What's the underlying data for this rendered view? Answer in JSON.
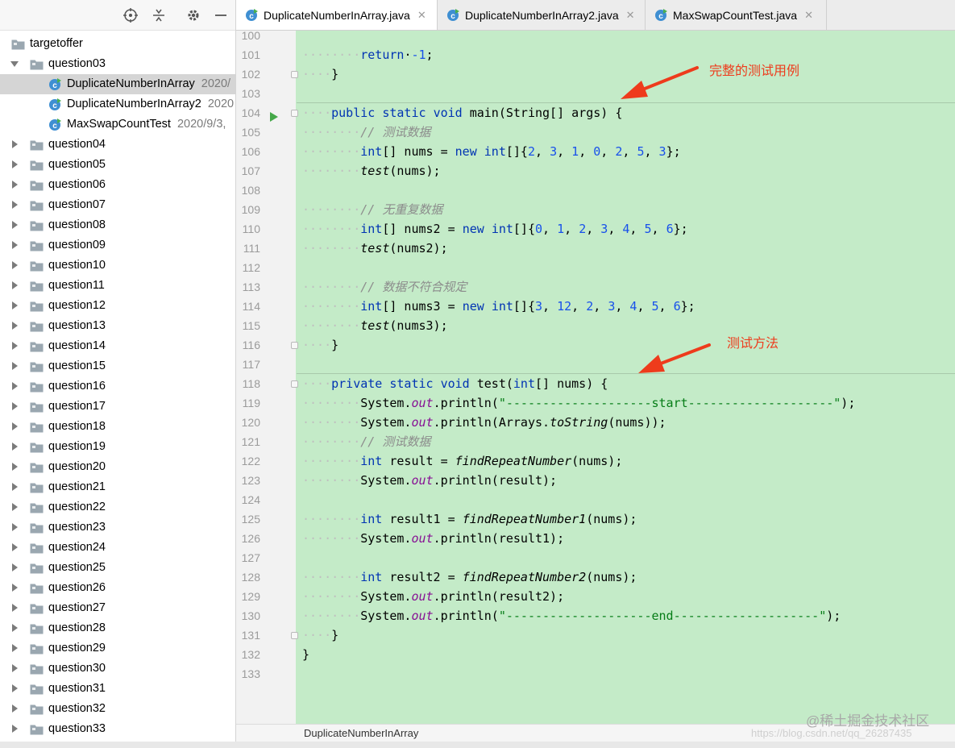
{
  "sidebar": {
    "toolbar_icons": [
      "locate-icon",
      "collapse-icon",
      "gear-icon",
      "minimize-icon"
    ],
    "tree": [
      {
        "label": "targetoffer",
        "type": "folder",
        "level": 0,
        "arrow": "none"
      },
      {
        "label": "question03",
        "type": "folder",
        "level": 1,
        "arrow": "expanded"
      },
      {
        "label": "DuplicateNumberInArray",
        "date": "2020/",
        "type": "class",
        "level": 2,
        "selected": true
      },
      {
        "label": "DuplicateNumberInArray2",
        "date": "2020",
        "type": "class",
        "level": 2
      },
      {
        "label": "MaxSwapCountTest",
        "date": "2020/9/3,",
        "type": "class",
        "level": 2
      },
      {
        "label": "question04",
        "type": "folder",
        "level": 1,
        "arrow": "collapsed"
      },
      {
        "label": "question05",
        "type": "folder",
        "level": 1,
        "arrow": "collapsed"
      },
      {
        "label": "question06",
        "type": "folder",
        "level": 1,
        "arrow": "collapsed"
      },
      {
        "label": "question07",
        "type": "folder",
        "level": 1,
        "arrow": "collapsed"
      },
      {
        "label": "question08",
        "type": "folder",
        "level": 1,
        "arrow": "collapsed"
      },
      {
        "label": "question09",
        "type": "folder",
        "level": 1,
        "arrow": "collapsed"
      },
      {
        "label": "question10",
        "type": "folder",
        "level": 1,
        "arrow": "collapsed"
      },
      {
        "label": "question11",
        "type": "folder",
        "level": 1,
        "arrow": "collapsed"
      },
      {
        "label": "question12",
        "type": "folder",
        "level": 1,
        "arrow": "collapsed"
      },
      {
        "label": "question13",
        "type": "folder",
        "level": 1,
        "arrow": "collapsed"
      },
      {
        "label": "question14",
        "type": "folder",
        "level": 1,
        "arrow": "collapsed"
      },
      {
        "label": "question15",
        "type": "folder",
        "level": 1,
        "arrow": "collapsed"
      },
      {
        "label": "question16",
        "type": "folder",
        "level": 1,
        "arrow": "collapsed"
      },
      {
        "label": "question17",
        "type": "folder",
        "level": 1,
        "arrow": "collapsed"
      },
      {
        "label": "question18",
        "type": "folder",
        "level": 1,
        "arrow": "collapsed"
      },
      {
        "label": "question19",
        "type": "folder",
        "level": 1,
        "arrow": "collapsed"
      },
      {
        "label": "question20",
        "type": "folder",
        "level": 1,
        "arrow": "collapsed"
      },
      {
        "label": "question21",
        "type": "folder",
        "level": 1,
        "arrow": "collapsed"
      },
      {
        "label": "question22",
        "type": "folder",
        "level": 1,
        "arrow": "collapsed"
      },
      {
        "label": "question23",
        "type": "folder",
        "level": 1,
        "arrow": "collapsed"
      },
      {
        "label": "question24",
        "type": "folder",
        "level": 1,
        "arrow": "collapsed"
      },
      {
        "label": "question25",
        "type": "folder",
        "level": 1,
        "arrow": "collapsed"
      },
      {
        "label": "question26",
        "type": "folder",
        "level": 1,
        "arrow": "collapsed"
      },
      {
        "label": "question27",
        "type": "folder",
        "level": 1,
        "arrow": "collapsed"
      },
      {
        "label": "question28",
        "type": "folder",
        "level": 1,
        "arrow": "collapsed"
      },
      {
        "label": "question29",
        "type": "folder",
        "level": 1,
        "arrow": "collapsed"
      },
      {
        "label": "question30",
        "type": "folder",
        "level": 1,
        "arrow": "collapsed"
      },
      {
        "label": "question31",
        "type": "folder",
        "level": 1,
        "arrow": "collapsed"
      },
      {
        "label": "question32",
        "type": "folder",
        "level": 1,
        "arrow": "collapsed"
      },
      {
        "label": "question33",
        "type": "folder",
        "level": 1,
        "arrow": "collapsed"
      }
    ]
  },
  "tabs": [
    {
      "label": "DuplicateNumberInArray.java",
      "active": true
    },
    {
      "label": "DuplicateNumberInArray2.java",
      "active": false
    },
    {
      "label": "MaxSwapCountTest.java",
      "active": false
    }
  ],
  "editor": {
    "lines": [
      {
        "n": "100",
        "tokens": []
      },
      {
        "n": "101",
        "tokens": [
          [
            "dot",
            "········"
          ],
          [
            "kw",
            "return"
          ],
          [
            "",
            "·"
          ],
          [
            "num",
            "-1"
          ],
          [
            "",
            ";"
          ]
        ]
      },
      {
        "n": "102",
        "fold": true,
        "tokens": [
          [
            "dot",
            "····"
          ],
          [
            "",
            "}"
          ]
        ]
      },
      {
        "n": "103",
        "tokens": []
      },
      {
        "n": "104",
        "sep": true,
        "run": true,
        "fold": true,
        "tokens": [
          [
            "dot",
            "····"
          ],
          [
            "kw",
            "public"
          ],
          [
            "",
            " "
          ],
          [
            "kw",
            "static"
          ],
          [
            "",
            " "
          ],
          [
            "kw",
            "void"
          ],
          [
            "",
            " main(String[] args) {"
          ]
        ]
      },
      {
        "n": "105",
        "tokens": [
          [
            "dot",
            "········"
          ],
          [
            "cmt",
            "// 测试数据"
          ]
        ]
      },
      {
        "n": "106",
        "tokens": [
          [
            "dot",
            "········"
          ],
          [
            "kw",
            "int"
          ],
          [
            "",
            "[] nums = "
          ],
          [
            "kw",
            "new"
          ],
          [
            "",
            " "
          ],
          [
            "kw",
            "int"
          ],
          [
            "",
            "[]{"
          ],
          [
            "num",
            "2"
          ],
          [
            "",
            ", "
          ],
          [
            "num",
            "3"
          ],
          [
            "",
            ", "
          ],
          [
            "num",
            "1"
          ],
          [
            "",
            ", "
          ],
          [
            "num",
            "0"
          ],
          [
            "",
            ", "
          ],
          [
            "num",
            "2"
          ],
          [
            "",
            ", "
          ],
          [
            "num",
            "5"
          ],
          [
            "",
            ", "
          ],
          [
            "num",
            "3"
          ],
          [
            "",
            "};"
          ]
        ]
      },
      {
        "n": "107",
        "tokens": [
          [
            "dot",
            "········"
          ],
          [
            "st",
            "test"
          ],
          [
            "",
            "(nums);"
          ]
        ]
      },
      {
        "n": "108",
        "tokens": []
      },
      {
        "n": "109",
        "tokens": [
          [
            "dot",
            "········"
          ],
          [
            "cmt",
            "// 无重复数据"
          ]
        ]
      },
      {
        "n": "110",
        "tokens": [
          [
            "dot",
            "········"
          ],
          [
            "kw",
            "int"
          ],
          [
            "",
            "[] nums2 = "
          ],
          [
            "kw",
            "new"
          ],
          [
            "",
            " "
          ],
          [
            "kw",
            "int"
          ],
          [
            "",
            "[]{"
          ],
          [
            "num",
            "0"
          ],
          [
            "",
            ", "
          ],
          [
            "num",
            "1"
          ],
          [
            "",
            ", "
          ],
          [
            "num",
            "2"
          ],
          [
            "",
            ", "
          ],
          [
            "num",
            "3"
          ],
          [
            "",
            ", "
          ],
          [
            "num",
            "4"
          ],
          [
            "",
            ", "
          ],
          [
            "num",
            "5"
          ],
          [
            "",
            ", "
          ],
          [
            "num",
            "6"
          ],
          [
            "",
            "};"
          ]
        ]
      },
      {
        "n": "111",
        "tokens": [
          [
            "dot",
            "········"
          ],
          [
            "st",
            "test"
          ],
          [
            "",
            "(nums2);"
          ]
        ]
      },
      {
        "n": "112",
        "tokens": []
      },
      {
        "n": "113",
        "tokens": [
          [
            "dot",
            "········"
          ],
          [
            "cmt",
            "// 数据不符合规定"
          ]
        ]
      },
      {
        "n": "114",
        "tokens": [
          [
            "dot",
            "········"
          ],
          [
            "kw",
            "int"
          ],
          [
            "",
            "[] nums3 = "
          ],
          [
            "kw",
            "new"
          ],
          [
            "",
            " "
          ],
          [
            "kw",
            "int"
          ],
          [
            "",
            "[]{"
          ],
          [
            "num",
            "3"
          ],
          [
            "",
            ", "
          ],
          [
            "num",
            "12"
          ],
          [
            "",
            ", "
          ],
          [
            "num",
            "2"
          ],
          [
            "",
            ", "
          ],
          [
            "num",
            "3"
          ],
          [
            "",
            ", "
          ],
          [
            "num",
            "4"
          ],
          [
            "",
            ", "
          ],
          [
            "num",
            "5"
          ],
          [
            "",
            ", "
          ],
          [
            "num",
            "6"
          ],
          [
            "",
            "};"
          ]
        ]
      },
      {
        "n": "115",
        "tokens": [
          [
            "dot",
            "········"
          ],
          [
            "st",
            "test"
          ],
          [
            "",
            "(nums3);"
          ]
        ]
      },
      {
        "n": "116",
        "fold": true,
        "tokens": [
          [
            "dot",
            "····"
          ],
          [
            "",
            "}"
          ]
        ]
      },
      {
        "n": "117",
        "tokens": []
      },
      {
        "n": "118",
        "sep": true,
        "fold": true,
        "tokens": [
          [
            "dot",
            "····"
          ],
          [
            "kw",
            "private"
          ],
          [
            "",
            " "
          ],
          [
            "kw",
            "static"
          ],
          [
            "",
            " "
          ],
          [
            "kw",
            "void"
          ],
          [
            "",
            " test("
          ],
          [
            "kw",
            "int"
          ],
          [
            "",
            "[] nums) {"
          ]
        ]
      },
      {
        "n": "119",
        "tokens": [
          [
            "dot",
            "········"
          ],
          [
            "",
            "System."
          ],
          [
            "fld",
            "out"
          ],
          [
            "",
            ".println("
          ],
          [
            "str",
            "\"--------------------start--------------------\""
          ],
          [
            "",
            ");"
          ]
        ]
      },
      {
        "n": "120",
        "tokens": [
          [
            "dot",
            "········"
          ],
          [
            "",
            "System."
          ],
          [
            "fld",
            "out"
          ],
          [
            "",
            ".println(Arrays."
          ],
          [
            "st",
            "toString"
          ],
          [
            "",
            "(nums));"
          ]
        ]
      },
      {
        "n": "121",
        "tokens": [
          [
            "dot",
            "········"
          ],
          [
            "cmt",
            "// 测试数据"
          ]
        ]
      },
      {
        "n": "122",
        "tokens": [
          [
            "dot",
            "········"
          ],
          [
            "kw",
            "int"
          ],
          [
            "",
            " result = "
          ],
          [
            "st",
            "findRepeatNumber"
          ],
          [
            "",
            "(nums);"
          ]
        ]
      },
      {
        "n": "123",
        "tokens": [
          [
            "dot",
            "········"
          ],
          [
            "",
            "System."
          ],
          [
            "fld",
            "out"
          ],
          [
            "",
            ".println(result);"
          ]
        ]
      },
      {
        "n": "124",
        "tokens": []
      },
      {
        "n": "125",
        "tokens": [
          [
            "dot",
            "········"
          ],
          [
            "kw",
            "int"
          ],
          [
            "",
            " result1 = "
          ],
          [
            "st",
            "findRepeatNumber1"
          ],
          [
            "",
            "(nums);"
          ]
        ]
      },
      {
        "n": "126",
        "tokens": [
          [
            "dot",
            "········"
          ],
          [
            "",
            "System."
          ],
          [
            "fld",
            "out"
          ],
          [
            "",
            ".println(result1);"
          ]
        ]
      },
      {
        "n": "127",
        "tokens": []
      },
      {
        "n": "128",
        "tokens": [
          [
            "dot",
            "········"
          ],
          [
            "kw",
            "int"
          ],
          [
            "",
            " result2 = "
          ],
          [
            "st",
            "findRepeatNumber2"
          ],
          [
            "",
            "(nums);"
          ]
        ]
      },
      {
        "n": "129",
        "tokens": [
          [
            "dot",
            "········"
          ],
          [
            "",
            "System."
          ],
          [
            "fld",
            "out"
          ],
          [
            "",
            ".println(result2);"
          ]
        ]
      },
      {
        "n": "130",
        "tokens": [
          [
            "dot",
            "········"
          ],
          [
            "",
            "System."
          ],
          [
            "fld",
            "out"
          ],
          [
            "",
            ".println("
          ],
          [
            "str",
            "\"--------------------end--------------------\""
          ],
          [
            "",
            ");"
          ]
        ]
      },
      {
        "n": "131",
        "fold": true,
        "tokens": [
          [
            "dot",
            "····"
          ],
          [
            "",
            "}"
          ]
        ]
      },
      {
        "n": "132",
        "tokens": [
          [
            "",
            "}"
          ]
        ]
      },
      {
        "n": "133",
        "tokens": []
      }
    ]
  },
  "annotations": {
    "full_test_case": "完整的测试用例",
    "test_method": "测试方法",
    "color": "#ee3b1c"
  },
  "status": {
    "breadcrumb": "DuplicateNumberInArray"
  },
  "watermark": {
    "main": "@稀土掘金技术社区",
    "url": "https://blog.csdn.net/qq_26287435"
  },
  "colors": {
    "code_bg": "#c4ebc8",
    "keyword": "#0033b3",
    "number": "#1750eb",
    "string": "#067d17",
    "field": "#871094"
  }
}
